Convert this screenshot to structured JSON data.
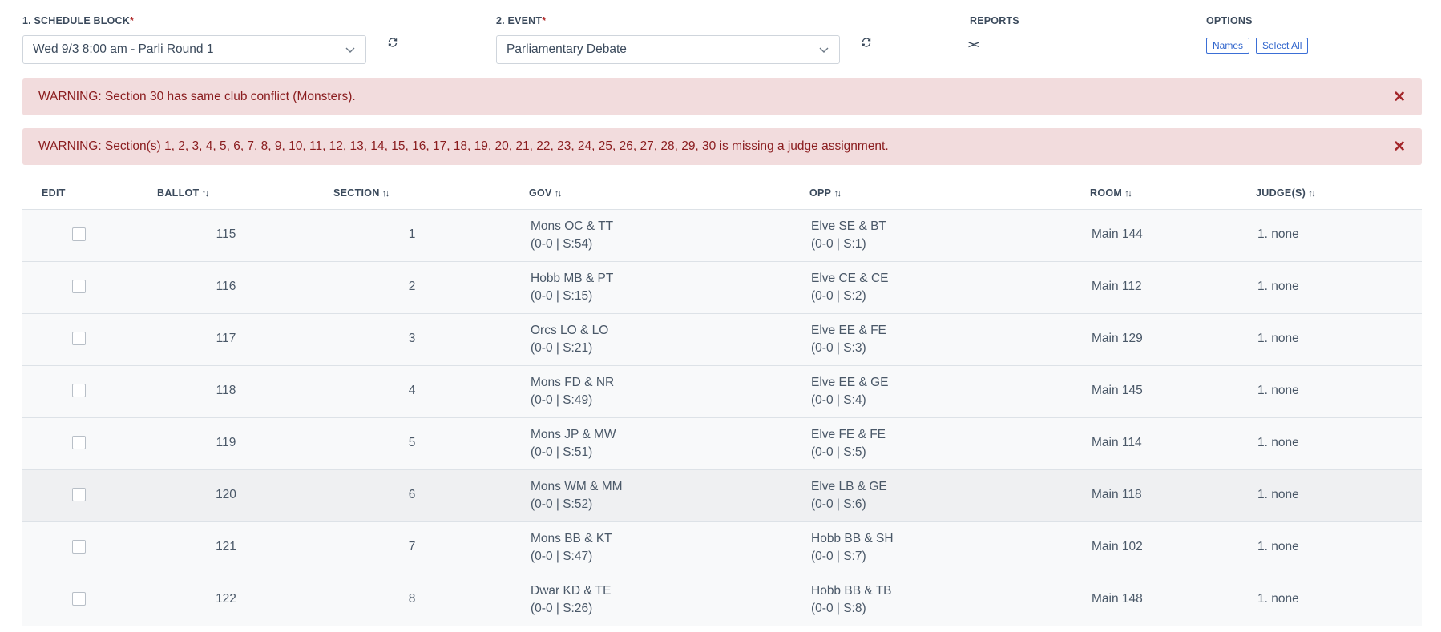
{
  "schedule": {
    "label": "1. SCHEDULE BLOCK",
    "required_mark": "*",
    "value": "Wed 9/3 8:00 am - Parli Round 1"
  },
  "event": {
    "label": "2. EVENT",
    "required_mark": "*",
    "value": "Parliamentary Debate"
  },
  "reports": {
    "label": "REPORTS",
    "icon_text": "><"
  },
  "options": {
    "label": "OPTIONS",
    "names_button": "Names",
    "select_all_button": "Select All"
  },
  "alerts": [
    {
      "text": "WARNING: Section 30 has same club conflict (Monsters).",
      "close": "✕"
    },
    {
      "text": "WARNING: Section(s) 1, 2, 3, 4, 5, 6, 7, 8, 9, 10, 11, 12, 13, 14, 15, 16, 17, 18, 19, 20, 21, 22, 23, 24, 25, 26, 27, 28, 29, 30 is missing a judge assignment.",
      "close": "✕"
    }
  ],
  "table": {
    "headers": {
      "edit": "EDIT",
      "ballot": "BALLOT",
      "section": "SECTION",
      "gov": "GOV",
      "opp": "OPP",
      "room": "ROOM",
      "judges": "JUDGE(S)",
      "sort_glyph": "↑↓"
    },
    "rows": [
      {
        "ballot": "115",
        "section": "1",
        "gov_name": "Mons OC & TT",
        "gov_stat": "(0-0 | S:54)",
        "opp_name": "Elve SE & BT",
        "opp_stat": "(0-0 | S:1)",
        "room": "Main 144",
        "judge": "1. none"
      },
      {
        "ballot": "116",
        "section": "2",
        "gov_name": "Hobb MB & PT",
        "gov_stat": "(0-0 | S:15)",
        "opp_name": "Elve CE & CE",
        "opp_stat": "(0-0 | S:2)",
        "room": "Main 112",
        "judge": "1. none"
      },
      {
        "ballot": "117",
        "section": "3",
        "gov_name": "Orcs LO & LO",
        "gov_stat": "(0-0 | S:21)",
        "opp_name": "Elve EE & FE",
        "opp_stat": "(0-0 | S:3)",
        "room": "Main 129",
        "judge": "1. none"
      },
      {
        "ballot": "118",
        "section": "4",
        "gov_name": "Mons FD & NR",
        "gov_stat": "(0-0 | S:49)",
        "opp_name": "Elve EE & GE",
        "opp_stat": "(0-0 | S:4)",
        "room": "Main 145",
        "judge": "1. none"
      },
      {
        "ballot": "119",
        "section": "5",
        "gov_name": "Mons JP & MW",
        "gov_stat": "(0-0 | S:51)",
        "opp_name": "Elve FE & FE",
        "opp_stat": "(0-0 | S:5)",
        "room": "Main 114",
        "judge": "1. none"
      },
      {
        "ballot": "120",
        "section": "6",
        "gov_name": "Mons WM & MM",
        "gov_stat": "(0-0 | S:52)",
        "opp_name": "Elve LB & GE",
        "opp_stat": "(0-0 | S:6)",
        "room": "Main 118",
        "judge": "1. none"
      },
      {
        "ballot": "121",
        "section": "7",
        "gov_name": "Mons BB & KT",
        "gov_stat": "(0-0 | S:47)",
        "opp_name": "Hobb BB & SH",
        "opp_stat": "(0-0 | S:7)",
        "room": "Main 102",
        "judge": "1. none"
      },
      {
        "ballot": "122",
        "section": "8",
        "gov_name": "Dwar KD & TE",
        "gov_stat": "(0-0 | S:26)",
        "opp_name": "Hobb BB & TB",
        "opp_stat": "(0-0 | S:8)",
        "room": "Main 148",
        "judge": "1. none"
      }
    ]
  }
}
